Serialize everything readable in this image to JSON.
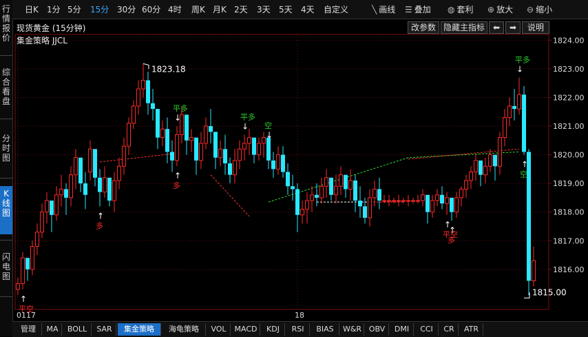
{
  "sidebar": {
    "tabs": [
      {
        "label": "行情报价",
        "active": false
      },
      {
        "label": "综合看盘",
        "active": false
      },
      {
        "label": "分时图",
        "active": false
      },
      {
        "label": "K线图",
        "active": true
      },
      {
        "label": "闪电图",
        "active": false
      }
    ]
  },
  "toolbar": {
    "periods": [
      "日K",
      "1分",
      "5分",
      "15分",
      "30分",
      "60分",
      "4时",
      "周K",
      "月K",
      "2天",
      "3天",
      "5天",
      "4天",
      "自定义"
    ],
    "active_period": "15分",
    "tools": [
      {
        "label": "画线",
        "icon": "draw-line-icon"
      },
      {
        "label": "叠加",
        "icon": "overlay-stack-icon"
      },
      {
        "label": "套利",
        "icon": "arbitrage-bag-icon"
      },
      {
        "label": "放大",
        "icon": "zoom-in-icon"
      },
      {
        "label": "缩小",
        "icon": "zoom-out-icon"
      }
    ]
  },
  "info": {
    "title": "现货黄金 (15分钟)",
    "buttons": {
      "modify_params": "改参数",
      "hide_indicator": "隐藏主指标",
      "prev": "⬅",
      "next": "➡",
      "help": "说明"
    }
  },
  "strategy_label": "集金策略 JJCL",
  "bottom_tabs": [
    "管理",
    "MA",
    "BOLL",
    "SAR",
    "集金策略",
    "海龟策略",
    "VOL",
    "MACD",
    "KDJ",
    "RSI",
    "BIAS",
    "W&R",
    "OBV",
    "DMI",
    "CCI",
    "CR",
    "ATR"
  ],
  "active_bottom_tab": "集金策略",
  "colors": {
    "up": "#ff2a2a",
    "down": "#29e8ff",
    "grid": "#6e1212",
    "signal_green": "#2ecc2e",
    "signal_red": "#ff2a2a"
  },
  "chart_data": {
    "type": "candlestick",
    "title": "现货黄金 (15分钟)",
    "ylim": [
      1814.6,
      1824.2
    ],
    "y_ticks": [
      1824,
      1823,
      1822,
      1821,
      1820,
      1819,
      1818,
      1817,
      1816
    ],
    "y_tick_labels": [
      "1824.00",
      "1823.00",
      "1822.00",
      "1821.00",
      "1820.00",
      "1819.00",
      "1818.00",
      "1817.00",
      "1816.00"
    ],
    "x_labels": [
      {
        "index": 0,
        "label": "0117"
      },
      {
        "index": 58,
        "label": "18"
      }
    ],
    "max_label": {
      "index": 26,
      "value": 1823.18,
      "text": "1823.18"
    },
    "min_label": {
      "index": 105,
      "value": 1815.0,
      "text": "1815.00"
    },
    "candles": [
      [
        1815.3,
        1815.7,
        1815.1,
        1815.5
      ],
      [
        1815.5,
        1816.6,
        1815.3,
        1816.4
      ],
      [
        1816.4,
        1816.2,
        1815.6,
        1816.0
      ],
      [
        1816.0,
        1817.0,
        1815.8,
        1816.8
      ],
      [
        1816.8,
        1817.6,
        1816.5,
        1817.3
      ],
      [
        1817.3,
        1818.3,
        1817.1,
        1818.0
      ],
      [
        1818.0,
        1818.7,
        1817.6,
        1818.4
      ],
      [
        1818.4,
        1818.2,
        1817.3,
        1817.9
      ],
      [
        1817.9,
        1818.9,
        1817.7,
        1818.6
      ],
      [
        1818.6,
        1819.3,
        1818.2,
        1818.8
      ],
      [
        1818.8,
        1819.0,
        1817.9,
        1818.5
      ],
      [
        1818.5,
        1819.6,
        1818.2,
        1819.3
      ],
      [
        1819.3,
        1820.2,
        1818.8,
        1819.9
      ],
      [
        1819.9,
        1819.8,
        1818.7,
        1819.0
      ],
      [
        1819.0,
        1819.4,
        1818.1,
        1818.6
      ],
      [
        1819.4,
        1820.5,
        1819.1,
        1820.2
      ],
      [
        1820.2,
        1820.0,
        1818.9,
        1819.2
      ],
      [
        1819.2,
        1819.5,
        1818.2,
        1818.7
      ],
      [
        1818.7,
        1819.6,
        1818.5,
        1819.2
      ],
      [
        1819.2,
        1819.0,
        1818.2,
        1818.4
      ],
      [
        1818.4,
        1819.4,
        1818.0,
        1819.1
      ],
      [
        1819.1,
        1819.9,
        1818.8,
        1819.6
      ],
      [
        1819.6,
        1820.6,
        1819.3,
        1820.3
      ],
      [
        1820.3,
        1821.3,
        1820.0,
        1821.1
      ],
      [
        1821.1,
        1821.9,
        1820.9,
        1821.7
      ],
      [
        1821.7,
        1822.6,
        1821.4,
        1822.3
      ],
      [
        1822.3,
        1823.18,
        1822.0,
        1822.6
      ],
      [
        1822.6,
        1822.9,
        1821.4,
        1821.8
      ],
      [
        1821.8,
        1822.3,
        1821.2,
        1821.6
      ],
      [
        1821.6,
        1821.4,
        1820.2,
        1820.6
      ],
      [
        1820.6,
        1821.2,
        1820.3,
        1820.9
      ],
      [
        1820.9,
        1821.3,
        1819.7,
        1820.1
      ],
      [
        1820.1,
        1820.5,
        1819.4,
        1819.8
      ],
      [
        1819.8,
        1821.0,
        1819.6,
        1820.7
      ],
      [
        1820.7,
        1821.7,
        1820.4,
        1821.4
      ],
      [
        1821.4,
        1821.2,
        1820.0,
        1820.5
      ],
      [
        1820.5,
        1820.9,
        1820.1,
        1820.6
      ],
      [
        1820.6,
        1820.4,
        1819.3,
        1819.8
      ],
      [
        1819.8,
        1820.8,
        1819.5,
        1820.4
      ],
      [
        1820.4,
        1821.3,
        1820.2,
        1821.0
      ],
      [
        1821.0,
        1821.6,
        1820.4,
        1820.8
      ],
      [
        1820.8,
        1820.6,
        1819.5,
        1819.9
      ],
      [
        1819.9,
        1820.5,
        1819.6,
        1820.2
      ],
      [
        1820.2,
        1820.7,
        1819.3,
        1819.7
      ],
      [
        1819.7,
        1819.9,
        1819.0,
        1819.3
      ],
      [
        1819.3,
        1820.2,
        1819.0,
        1819.8
      ],
      [
        1819.8,
        1820.5,
        1819.5,
        1820.2
      ],
      [
        1820.2,
        1820.7,
        1819.8,
        1820.4
      ],
      [
        1820.4,
        1820.9,
        1820.0,
        1820.6
      ],
      [
        1820.6,
        1820.4,
        1819.7,
        1820.0
      ],
      [
        1820.0,
        1820.6,
        1819.8,
        1820.4
      ],
      [
        1820.4,
        1820.8,
        1819.9,
        1820.6
      ],
      [
        1820.6,
        1820.4,
        1819.5,
        1819.8
      ],
      [
        1819.8,
        1820.1,
        1819.2,
        1819.5
      ],
      [
        1819.5,
        1820.3,
        1819.3,
        1820.0
      ],
      [
        1820.0,
        1820.3,
        1819.2,
        1819.4
      ],
      [
        1819.4,
        1819.7,
        1818.6,
        1818.9
      ],
      [
        1818.9,
        1819.3,
        1818.4,
        1818.8
      ],
      [
        1818.8,
        1819.0,
        1817.3,
        1817.9
      ],
      [
        1817.9,
        1818.4,
        1817.6,
        1818.1
      ],
      [
        1818.1,
        1818.7,
        1817.6,
        1818.4
      ],
      [
        1818.4,
        1818.9,
        1818.0,
        1818.6
      ],
      [
        1818.6,
        1819.0,
        1818.2,
        1818.5
      ],
      [
        1818.5,
        1819.2,
        1818.3,
        1818.9
      ],
      [
        1818.9,
        1819.5,
        1818.5,
        1819.2
      ],
      [
        1819.2,
        1819.0,
        1818.4,
        1818.6
      ],
      [
        1818.6,
        1819.3,
        1818.3,
        1818.9
      ],
      [
        1818.9,
        1819.6,
        1818.6,
        1819.3
      ],
      [
        1819.3,
        1819.1,
        1818.5,
        1818.8
      ],
      [
        1818.8,
        1819.5,
        1818.4,
        1819.1
      ],
      [
        1819.1,
        1819.3,
        1818.0,
        1818.4
      ],
      [
        1818.4,
        1818.9,
        1817.8,
        1818.2
      ],
      [
        1818.2,
        1818.5,
        1817.6,
        1817.8
      ],
      [
        1817.8,
        1818.8,
        1817.5,
        1818.5
      ],
      [
        1818.5,
        1819.1,
        1818.2,
        1818.8
      ],
      [
        1818.8,
        1819.2,
        1818.1,
        1818.4
      ],
      [
        1818.4,
        1818.6,
        1818.3,
        1818.4
      ],
      [
        1818.4,
        1818.6,
        1818.2,
        1818.4
      ],
      [
        1818.4,
        1818.5,
        1818.3,
        1818.4
      ],
      [
        1818.4,
        1818.6,
        1818.2,
        1818.4
      ],
      [
        1818.4,
        1818.5,
        1818.3,
        1818.4
      ],
      [
        1818.4,
        1818.6,
        1818.2,
        1818.4
      ],
      [
        1818.4,
        1818.5,
        1818.3,
        1818.4
      ],
      [
        1818.4,
        1818.6,
        1818.3,
        1818.4
      ],
      [
        1818.4,
        1818.8,
        1818.2,
        1818.6
      ],
      [
        1818.6,
        1818.4,
        1817.6,
        1818.0
      ],
      [
        1818.0,
        1818.6,
        1817.8,
        1818.4
      ],
      [
        1818.4,
        1818.8,
        1818.2,
        1818.6
      ],
      [
        1818.6,
        1818.9,
        1818.1,
        1818.3
      ],
      [
        1818.3,
        1818.7,
        1817.9,
        1818.5
      ],
      [
        1818.5,
        1818.3,
        1817.7,
        1818.0
      ],
      [
        1818.0,
        1818.7,
        1817.8,
        1818.5
      ],
      [
        1818.5,
        1818.9,
        1818.2,
        1818.8
      ],
      [
        1818.8,
        1819.3,
        1818.5,
        1819.1
      ],
      [
        1819.1,
        1819.6,
        1818.8,
        1819.4
      ],
      [
        1819.4,
        1820.0,
        1819.1,
        1819.8
      ],
      [
        1819.8,
        1819.6,
        1818.9,
        1819.3
      ],
      [
        1819.3,
        1819.9,
        1819.0,
        1819.6
      ],
      [
        1819.6,
        1820.2,
        1819.4,
        1820.0
      ],
      [
        1820.0,
        1819.8,
        1819.1,
        1819.6
      ],
      [
        1819.6,
        1820.8,
        1819.3,
        1820.6
      ],
      [
        1820.6,
        1821.6,
        1820.3,
        1821.3
      ],
      [
        1821.3,
        1822.0,
        1821.0,
        1821.7
      ],
      [
        1821.7,
        1822.3,
        1821.2,
        1821.6
      ],
      [
        1821.6,
        1822.7,
        1821.4,
        1822.1
      ],
      [
        1822.1,
        1822.4,
        1820.0,
        1820.1
      ],
      [
        1820.1,
        1820.2,
        1815.1,
        1815.6
      ],
      [
        1815.6,
        1816.8,
        1815.4,
        1816.3
      ]
    ],
    "signals": [
      {
        "index": 1,
        "type": "buy",
        "label": "平空"
      },
      {
        "index": 17,
        "type": "buy",
        "label": "多"
      },
      {
        "index": 33,
        "type": "sell",
        "label": "平多"
      },
      {
        "index": 33,
        "type": "buy",
        "label": "多"
      },
      {
        "index": 47,
        "type": "sell",
        "label": "平多"
      },
      {
        "index": 52,
        "type": "sell",
        "label": "空"
      },
      {
        "index": 89,
        "type": "buy",
        "label": "平空"
      },
      {
        "index": 90,
        "type": "buy",
        "label": "多"
      },
      {
        "index": 104,
        "type": "sell",
        "label": "平多"
      },
      {
        "index": 105,
        "type": "buy",
        "label": "空"
      }
    ],
    "trend_lines": [
      {
        "color": "red",
        "points": [
          [
            17,
            1819.75
          ],
          [
            33,
            1820.05
          ]
        ]
      },
      {
        "color": "red",
        "points": [
          [
            40,
            1819.3
          ],
          [
            48,
            1817.85
          ]
        ]
      },
      {
        "color": "green",
        "points": [
          [
            52,
            1818.35
          ],
          [
            81,
            1819.9
          ],
          [
            104,
            1820.1
          ]
        ]
      },
      {
        "color": "white",
        "points": [
          [
            62,
            1818.35
          ],
          [
            73,
            1818.35
          ]
        ]
      },
      {
        "color": "red",
        "points": [
          [
            73,
            1818.35
          ],
          [
            80,
            1818.35
          ]
        ]
      },
      {
        "color": "red",
        "points": [
          [
            81,
            1819.85
          ],
          [
            104,
            1820.2
          ]
        ]
      }
    ]
  }
}
